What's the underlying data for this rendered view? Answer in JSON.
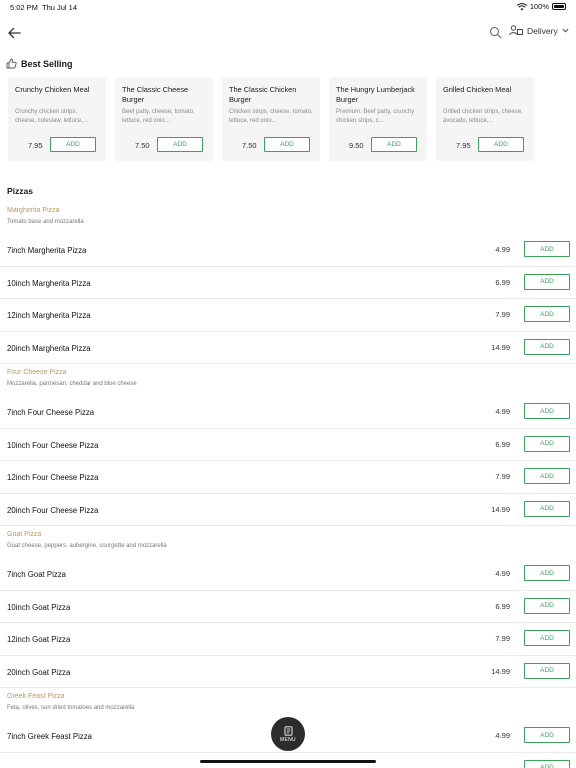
{
  "status_bar": {
    "time": "5:02 PM",
    "date": "Thu Jul 14",
    "battery": "100%"
  },
  "nav": {
    "delivery_label": "Delivery"
  },
  "best_selling": {
    "title": "Best Selling",
    "add_label": "ADD",
    "items": [
      {
        "name": "Crunchy Chicken Meal",
        "desc": "Crunchy chicken strips, cheese, coleslaw, lettuce,...",
        "price": "7.95"
      },
      {
        "name": "The Classic Cheese Burger",
        "desc": "Beef patty, cheese, tomato, lettuce, red onio...",
        "price": "7.50"
      },
      {
        "name": "The Classic Chicken Burger",
        "desc": "Chicken strips, cheese, tomato, lettuce, red onio...",
        "price": "7.50"
      },
      {
        "name": "The Hungry Lumberjack Burger",
        "desc": "Premium. Beef patty, crunchy chicken strips, c...",
        "price": "9.50"
      },
      {
        "name": "Grilled Chicken Meal",
        "desc": "Grilled chicken strips, cheese, avocado, lettuce,...",
        "price": "7.95"
      }
    ]
  },
  "section": {
    "title": "Pizzas",
    "add_label": "ADD"
  },
  "groups": [
    {
      "name": "Margherita Pizza",
      "desc": "Tomato base and mozzarella",
      "items": [
        {
          "name": "7inch Margherita Pizza",
          "price": "4.99"
        },
        {
          "name": "10inch Margherita Pizza",
          "price": "6.99"
        },
        {
          "name": "12inch Margherita Pizza",
          "price": "7.99"
        },
        {
          "name": "20inch Margherita Pizza",
          "price": "14.99"
        }
      ]
    },
    {
      "name": "Four Cheese Pizza",
      "desc": "Mozzarella, parmesan, cheddar and blue cheese",
      "items": [
        {
          "name": "7inch Four Cheese Pizza",
          "price": "4.99"
        },
        {
          "name": "10inch Four Cheese Pizza",
          "price": "6.99"
        },
        {
          "name": "12inch Four Cheese Pizza",
          "price": "7.99"
        },
        {
          "name": "20inch Four Cheese Pizza",
          "price": "14.99"
        }
      ]
    },
    {
      "name": "Goat Pizza",
      "desc": "Goat cheese, peppers, aubergine, courgette and mozzarella",
      "items": [
        {
          "name": "7inch Goat Pizza",
          "price": "4.99"
        },
        {
          "name": "10inch Goat Pizza",
          "price": "6.99"
        },
        {
          "name": "12inch Goat Pizza",
          "price": "7.99"
        },
        {
          "name": "20inch Goat Pizza",
          "price": "14.99"
        }
      ]
    },
    {
      "name": "Greek Feast Pizza",
      "desc": "Feta, olives, sun dried tomatoes and mozzarella",
      "items": [
        {
          "name": "7inch Greek Feast Pizza",
          "price": "4.99"
        },
        {
          "name": "",
          "price": ""
        }
      ]
    }
  ],
  "menu_button": {
    "label": "MENU"
  },
  "colors": {
    "accent_green": "#3aa05a",
    "group_gold": "#b59a5e",
    "card_bg": "#f5f5f5"
  }
}
